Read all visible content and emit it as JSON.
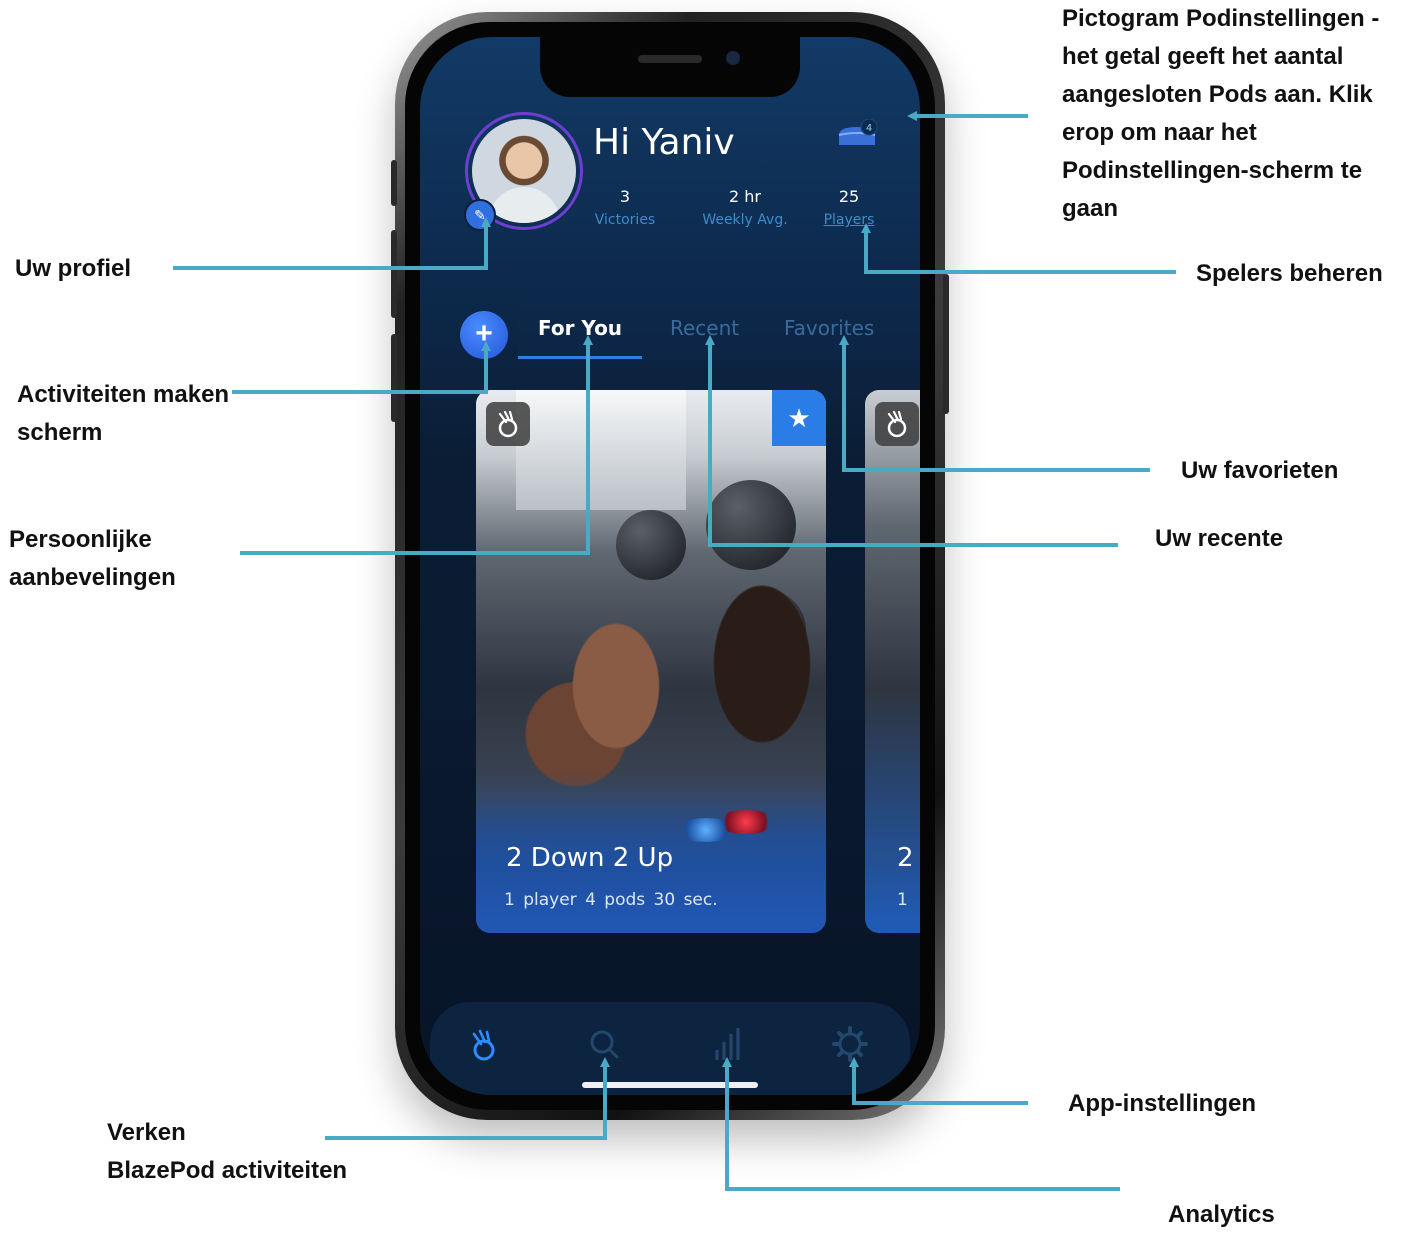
{
  "colors": {
    "accent": "#2f7fe0",
    "annotation_line": "#4aa9c4",
    "screen_bg": "#0b1d35",
    "tab_inactive": "#3b6b9a",
    "favorite_badge": "#2a7de6"
  },
  "header": {
    "greeting": "Hi Yaniv",
    "pods_connected": "4",
    "stats": [
      {
        "value": "3",
        "label": "Victories"
      },
      {
        "value": "2 hr",
        "label": "Weekly Avg."
      },
      {
        "value": "25",
        "label": "Players"
      }
    ]
  },
  "tabs": [
    {
      "label": "For You",
      "active": true
    },
    {
      "label": "Recent",
      "active": false
    },
    {
      "label": "Favorites",
      "active": false
    }
  ],
  "cards": [
    {
      "title": "2 Down 2 Up",
      "meta": "1 player  4 pods  30 sec.",
      "badge_icon": "blazepod-icon",
      "favorite_icon": "star-icon"
    },
    {
      "title": "2",
      "meta": "1"
    }
  ],
  "bottom_nav": [
    {
      "icon": "blazepod-icon",
      "active": true
    },
    {
      "icon": "search-icon",
      "active": false
    },
    {
      "icon": "analytics-icon",
      "active": false
    },
    {
      "icon": "settings-gear-icon",
      "active": false
    }
  ],
  "annotations": {
    "pod_settings": "Pictogram Podinstellingen -\nhet getal geeft het aantal\naangesloten Pods aan. Klik\nerop om naar het\nPodinstellingen-scherm te\ngaan",
    "profile": "Uw profiel",
    "manage_players": "Spelers beheren",
    "create_activities": "Activiteiten maken\nscherm",
    "favorites": "Uw favorieten",
    "recommendations": "Persoonlijke\naanbevelingen",
    "recent": "Uw recente",
    "app_settings": "App-instellingen",
    "explore": "Verken\nBlazePod activiteiten",
    "analytics": "Analytics"
  }
}
